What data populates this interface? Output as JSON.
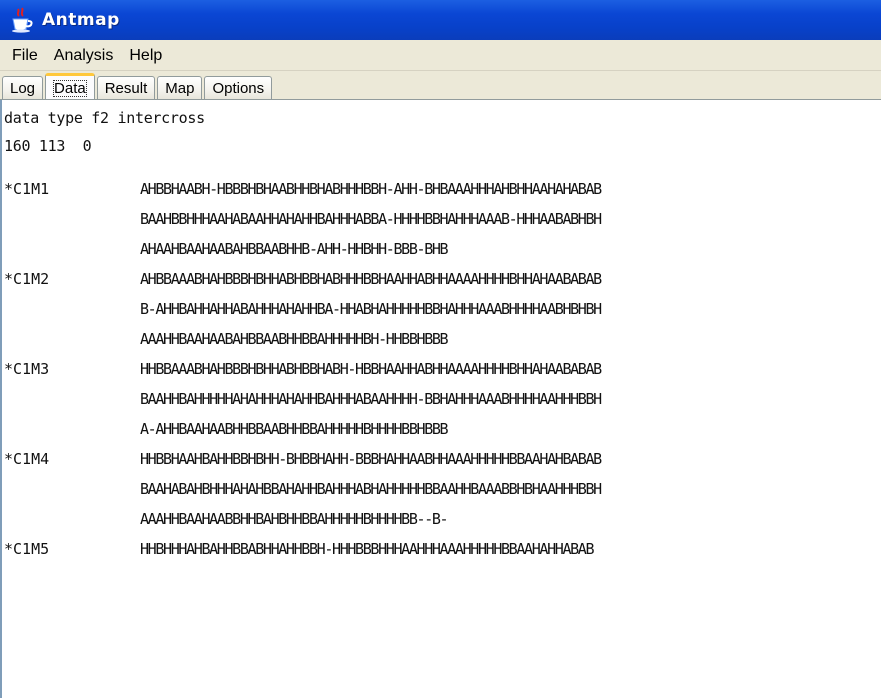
{
  "window": {
    "title": "Antmap",
    "icon": "java-cup-icon"
  },
  "menu": [
    "File",
    "Analysis",
    "Help"
  ],
  "tabs": [
    {
      "label": "Log"
    },
    {
      "label": "Data",
      "active": true
    },
    {
      "label": "Result"
    },
    {
      "label": "Map"
    },
    {
      "label": "Options"
    }
  ],
  "content": {
    "header": [
      "data type f2 intercross",
      "160 113  0"
    ],
    "markers": [
      {
        "name": "*C1M1",
        "lines": [
          "AHBBHAABH-HBBBHBHAABHHBHABHHHBBH-AHH-BHBAAAHHHAHBHHAAHAHABAB",
          "BAAHBBHHHAAHABAAHHAHAHHBAHHHABBA-HHHHBBHAHHHAAAB-HHHAABABHBH",
          "AHAAHBAAHAABAHBBAABHHB-AHH-HHBHH-BBB-BHB"
        ]
      },
      {
        "name": "*C1M2",
        "lines": [
          "AHBBAAABHAHBBBHBHHABHBBHABHHHBBHAAHHABHHAAAAHHHHBHHAHAABABAB",
          "B-AHHBAHHAHHABAHHHAHAHHBA-HHABHAHHHHHBBHAHHHAAABHHHHAABHBHBH",
          "AAAHHBAAHAABAHBBAABHHBBAHHHHHBH-HHBBHBBB"
        ]
      },
      {
        "name": "*C1M3",
        "lines": [
          "HHBBAAABHAHBBBHBHHABHBBHABH-HBBHAAHHABHHAAAAHHHHBHHAHAABABAB",
          "BAAHHBAHHHHHAHAHHHAHAHHBAHHHABAAHHHH-BBHAHHHAAABHHHHAAHHHBBH",
          "A-AHHBAAHAABHHBBAABHHBBAHHHHHBHHHHBBHBBB"
        ]
      },
      {
        "name": "*C1M4",
        "lines": [
          "HHBBHAAHBAHHBBHBHH-BHBBHAHH-BBBHAHHAABHHAAAHHHHHBBAAHAHBABAB",
          "BAAHABAHBHHHAHAHBBAHAHHBAHHHABHAHHHHHBBAAHHBAAABBHBHAAHHHBBH",
          "AAAHHBAAHAABBHHBAHBHHBBAHHHHHBHHHHBB--B-"
        ]
      },
      {
        "name": "*C1M5",
        "lines": [
          "HHBHHHAHBAHHBBABHHAHHBBH-HHHBBBHHHAAHHHAAAHHHHHBBAAHAHHABAB"
        ]
      }
    ]
  },
  "colors": {
    "titlebar": "#0a46d4",
    "menubar": "#ece9d8",
    "active_tab_highlight": "#ffc83c",
    "content_bg": "#ffffff",
    "text": "#111111"
  }
}
